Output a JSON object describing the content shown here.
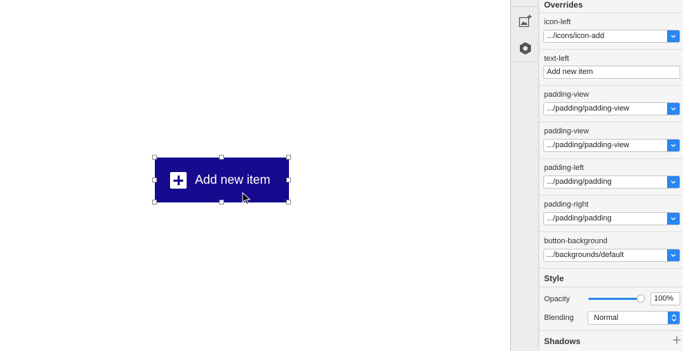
{
  "canvas": {
    "button": {
      "label": "Add new item",
      "icon": "plus-square-icon",
      "background": "#160a8e"
    }
  },
  "toolbar": {
    "icons": [
      "image-add-icon",
      "hexagon-icon"
    ]
  },
  "inspector": {
    "overrides_title": "Overrides",
    "fields": [
      {
        "label": "icon-left",
        "value": ".../icons/icon-add",
        "type": "select"
      },
      {
        "label": "text-left",
        "value": "Add new item",
        "type": "text"
      },
      {
        "label": "padding-view",
        "value": ".../padding/padding-view",
        "type": "select"
      },
      {
        "label": "padding-view",
        "value": ".../padding/padding-view",
        "type": "select"
      },
      {
        "label": "padding-left",
        "value": ".../padding/padding",
        "type": "select"
      },
      {
        "label": "padding-right",
        "value": ".../padding/padding",
        "type": "select"
      },
      {
        "label": "button-background",
        "value": ".../backgrounds/default",
        "type": "select"
      }
    ],
    "style_title": "Style",
    "opacity": {
      "label": "Opacity",
      "value": "100%",
      "level": 1.0
    },
    "blending": {
      "label": "Blending",
      "value": "Normal"
    },
    "shadows_title": "Shadows",
    "accent": "#2a86f0"
  }
}
